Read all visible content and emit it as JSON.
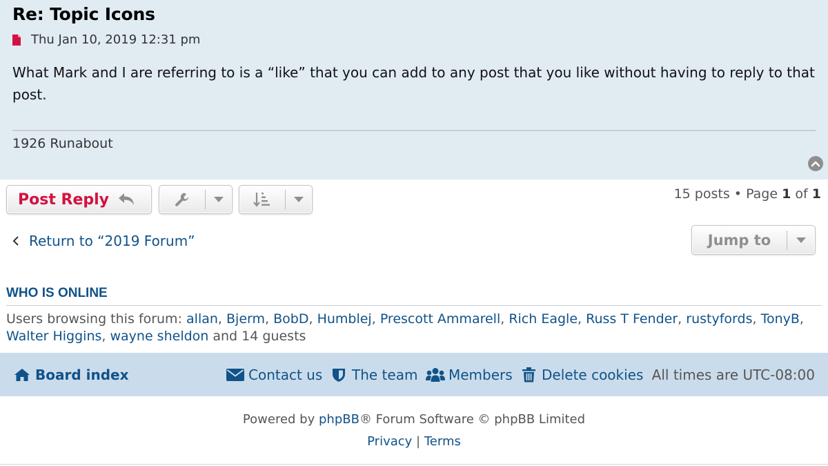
{
  "post": {
    "title": "Re: Topic Icons",
    "date": "Thu Jan 10, 2019 12:31 pm",
    "body": "What Mark and I are referring to is a “like” that you can add to any post that you like without having to reply to that post.",
    "signature": "1926 Runabout"
  },
  "actions": {
    "post_reply_label": "Post Reply",
    "pagination": {
      "posts": "15 posts",
      "bullet": "•",
      "page_word": "Page",
      "current": "1",
      "of_word": "of",
      "total": "1"
    },
    "return_label": "Return to “2019 Forum”",
    "jump_label": "Jump to"
  },
  "online": {
    "heading": "WHO IS ONLINE",
    "prefix": "Users browsing this forum:",
    "users": [
      "allan",
      "Bjerm",
      "BobD",
      "Humblej",
      "Prescott Ammarell",
      "Rich Eagle",
      "Russ T Fender",
      "rustyfords",
      "TonyB",
      "Walter Higgins",
      "wayne sheldon"
    ],
    "suffix": "and 14 guests"
  },
  "navbar": {
    "board_index": "Board index",
    "contact": "Contact us",
    "team": "The team",
    "members": "Members",
    "delete_cookies": "Delete cookies",
    "timezone": "All times are UTC-08:00"
  },
  "footer": {
    "powered_prefix": "Powered by",
    "phpbb_link": "phpBB",
    "powered_suffix": "® Forum Software © phpBB Limited",
    "privacy": "Privacy",
    "separator": "|",
    "terms": "Terms"
  },
  "colors": {
    "post_bg": "#e1ebf2",
    "link": "#105289",
    "reply_red": "#d31141",
    "navbar_bg": "#cadceb"
  },
  "icons": [
    "file-icon",
    "arrow-up-icon",
    "reply-icon",
    "wrench-icon",
    "sort-icon",
    "caret-down-icon",
    "chevron-left-icon",
    "home-icon",
    "envelope-icon",
    "shield-icon",
    "users-icon",
    "trash-icon"
  ]
}
